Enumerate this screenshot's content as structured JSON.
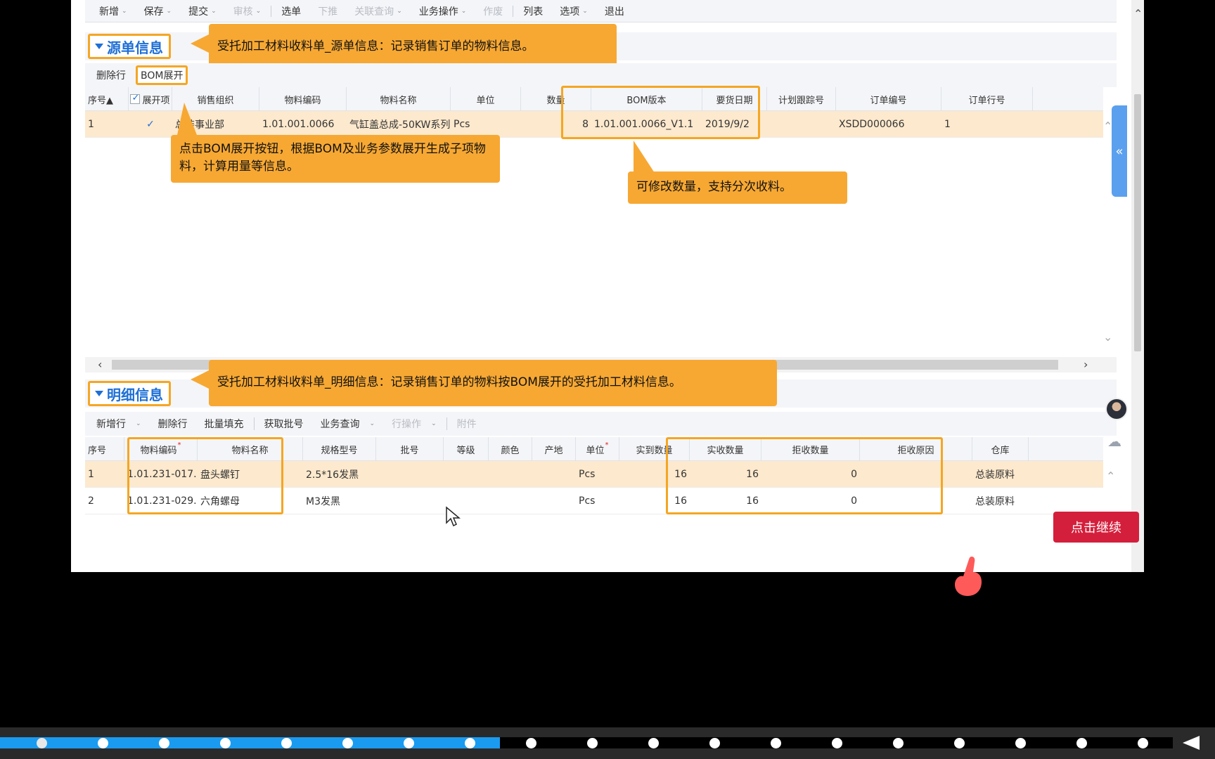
{
  "toolbar": {
    "items": [
      {
        "label": "新增",
        "caret": true,
        "disabled": false
      },
      {
        "label": "保存",
        "caret": true,
        "disabled": false
      },
      {
        "label": "提交",
        "caret": true,
        "disabled": false
      },
      {
        "label": "审核",
        "caret": true,
        "disabled": true
      },
      {
        "sep": true
      },
      {
        "label": "选单",
        "caret": false,
        "disabled": false
      },
      {
        "label": "下推",
        "caret": false,
        "disabled": true
      },
      {
        "label": "关联查询",
        "caret": true,
        "disabled": true
      },
      {
        "label": "业务操作",
        "caret": true,
        "disabled": false
      },
      {
        "label": "作废",
        "caret": false,
        "disabled": true
      },
      {
        "sep": true
      },
      {
        "label": "列表",
        "caret": false,
        "disabled": false
      },
      {
        "label": "选项",
        "caret": true,
        "disabled": false
      },
      {
        "label": "退出",
        "caret": false,
        "disabled": false
      }
    ]
  },
  "source_section": {
    "title": "源单信息",
    "callout": "受托加工材料收料单_源单信息：记录销售订单的物料信息。",
    "buttons": {
      "delete_row": "删除行",
      "bom_expand": "BOM展开"
    },
    "columns": [
      "序号▲",
      "展开项",
      "销售组织",
      "物料编码",
      "物料名称",
      "单位",
      "数量",
      "BOM版本",
      "要货日期",
      "计划跟踪号",
      "订单编号",
      "订单行号"
    ],
    "rows": [
      {
        "seq": "1",
        "expand": true,
        "org": "总装事业部",
        "code": "1.01.001.0066",
        "name": "气缸盖总成-50KW系列",
        "unit": "Pcs",
        "qty": "8",
        "bom": "1.01.001.0066_V1.1",
        "date": "2019/9/2",
        "track": "",
        "order": "XSDD000066",
        "line": "1"
      }
    ],
    "callout_bom": "点击BOM展开按钮，根据BOM及业务参数展开生成子项物料，计算用量等信息。",
    "callout_qty": "可修改数量，支持分次收料。"
  },
  "detail_section": {
    "title": "明细信息",
    "callout": "受托加工材料收料单_明细信息：记录销售订单的物料按BOM展开的受托加工材料信息。",
    "buttons": [
      {
        "label": "新增行",
        "caret": true,
        "disabled": false
      },
      {
        "label": "删除行",
        "caret": false,
        "disabled": false
      },
      {
        "label": "批量填充",
        "caret": false,
        "disabled": false
      },
      {
        "sep": true
      },
      {
        "label": "获取批号",
        "caret": false,
        "disabled": false
      },
      {
        "label": "业务查询",
        "caret": true,
        "disabled": false
      },
      {
        "label": "行操作",
        "caret": true,
        "disabled": true
      },
      {
        "sep": true
      },
      {
        "label": "附件",
        "caret": false,
        "disabled": true
      }
    ],
    "columns": [
      "序号",
      "物料编码",
      "物料名称",
      "规格型号",
      "批号",
      "等级",
      "颜色",
      "产地",
      "单位",
      "实到数量",
      "实收数量",
      "拒收数量",
      "拒收原因",
      "仓库"
    ],
    "rows": [
      {
        "seq": "1",
        "code": "1.01.231-017...",
        "name": "盘头螺钉",
        "spec": "2.5*16发黑",
        "unit": "Pcs",
        "arrived": "16",
        "received": "16",
        "rejected": "0",
        "warehouse": "总装原料"
      },
      {
        "seq": "2",
        "code": "1.01.231-029...",
        "name": "六角螺母",
        "spec": "M3发黑",
        "unit": "Pcs",
        "arrived": "16",
        "received": "16",
        "rejected": "0",
        "warehouse": "总装原料"
      }
    ]
  },
  "continue_button": "点击继续",
  "icons": {
    "collapse": "chevron-left-double-icon",
    "cloud": "cloud-icon",
    "avatar": "avatar"
  },
  "colors": {
    "accent": "#1e6fd6",
    "highlight": "#f5a623",
    "callout": "#f7a833",
    "continue": "#d41f3c",
    "progress": "#1a9bf0"
  },
  "progress": {
    "total_steps": 19,
    "completed_steps": 8
  }
}
